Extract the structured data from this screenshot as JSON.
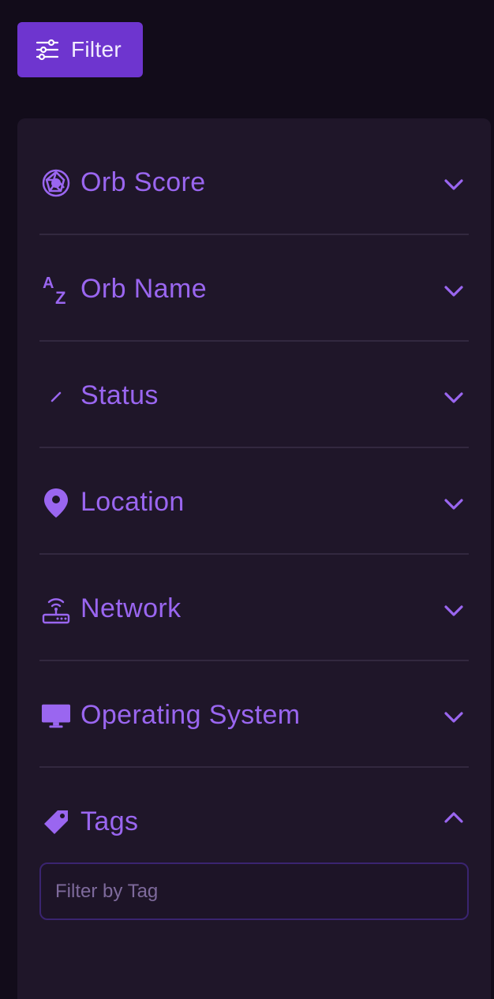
{
  "filter_button": {
    "label": "Filter"
  },
  "sections": [
    {
      "label": "Orb Score",
      "icon": "orb-icon",
      "expanded": false
    },
    {
      "label": "Orb Name",
      "icon": "sort-az-icon",
      "expanded": false
    },
    {
      "label": "Status",
      "icon": "status-slash-icon",
      "expanded": false
    },
    {
      "label": "Location",
      "icon": "map-pin-icon",
      "expanded": false
    },
    {
      "label": "Network",
      "icon": "router-icon",
      "expanded": false
    },
    {
      "label": "Operating System",
      "icon": "monitor-icon",
      "expanded": false
    },
    {
      "label": "Tags",
      "icon": "tag-icon",
      "expanded": true
    }
  ],
  "tags_filter": {
    "placeholder": "Filter by Tag",
    "value": ""
  },
  "colors": {
    "background": "#120c1a",
    "panel": "#1f1629",
    "accent": "#9a66f0",
    "button": "#6e35cf",
    "divider": "#32283f"
  }
}
